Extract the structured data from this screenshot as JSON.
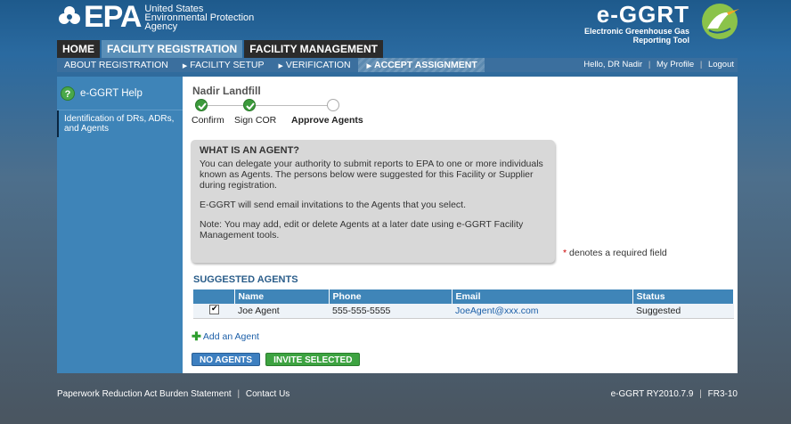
{
  "header": {
    "epa_mark": "EPA",
    "epa_line1": "United States",
    "epa_line2": "Environmental Protection",
    "epa_line3": "Agency",
    "app_title": "e-GGRT",
    "app_sub1": "Electronic Greenhouse Gas",
    "app_sub2": "Reporting Tool"
  },
  "tabs": [
    {
      "label": "HOME",
      "active": false
    },
    {
      "label": "FACILITY REGISTRATION",
      "active": true
    },
    {
      "label": "FACILITY MANAGEMENT",
      "active": false
    }
  ],
  "subnav": {
    "items": [
      "ABOUT REGISTRATION",
      "FACILITY SETUP",
      "VERIFICATION",
      "ACCEPT ASSIGNMENT"
    ],
    "user_greeting": "Hello, DR Nadir",
    "my_profile": "My Profile",
    "logout": "Logout"
  },
  "sidebar": {
    "help_label": "e-GGRT Help",
    "link": "Identification of DRs, ADRs, and Agents"
  },
  "main": {
    "facility_name": "Nadir Landfill",
    "steps": [
      {
        "label": "Confirm",
        "state": "done"
      },
      {
        "label": "Sign COR",
        "state": "done"
      },
      {
        "label": "Approve Agents",
        "state": "current"
      }
    ],
    "info": {
      "title": "WHAT IS AN AGENT?",
      "para1": "You can delegate your authority to submit reports to EPA to one or more individuals known as Agents. The persons below were suggested for this Facility or Supplier during registration.",
      "para2": "E-GGRT will send email invitations to the Agents that you select.",
      "para3": "Note: You may add, edit or delete Agents at a later date using e-GGRT Facility Management tools."
    },
    "required_star": "*",
    "required_note": "denotes a required field",
    "suggested_title": "SUGGESTED AGENTS",
    "table": {
      "headers": [
        "Name",
        "Phone",
        "Email",
        "Status"
      ],
      "rows": [
        {
          "checked": true,
          "name": "Joe Agent",
          "phone": "555-555-5555",
          "email": "JoeAgent@xxx.com",
          "status": "Suggested"
        }
      ]
    },
    "add_agent": "Add an Agent",
    "btn_no_agents": "NO AGENTS",
    "btn_invite": "INVITE SELECTED"
  },
  "footer": {
    "paperwork": "Paperwork Reduction Act Burden Statement",
    "contact": "Contact Us",
    "version": "e-GGRT RY2010.7.9",
    "code": "FR3-10"
  },
  "colors": {
    "accent": "#3f85b8",
    "tab_active": "#5a8fb8",
    "tab_dark": "#2b2b2b",
    "green": "#3da341"
  }
}
